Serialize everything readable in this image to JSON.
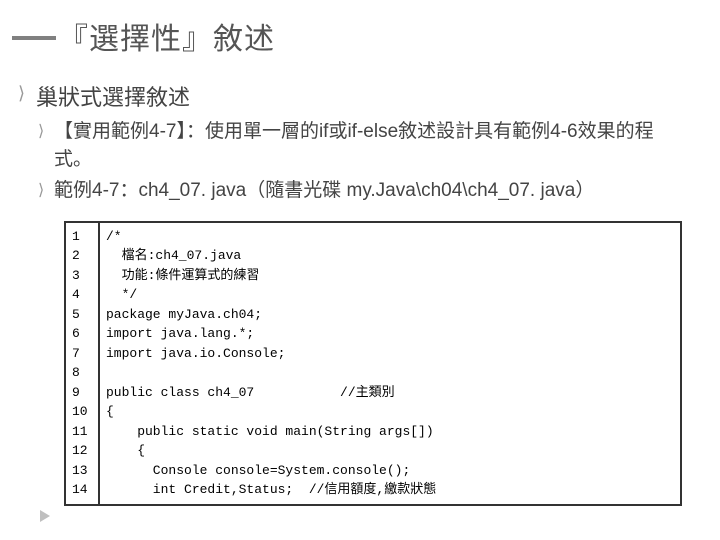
{
  "title": "『選擇性』敘述",
  "bullets": {
    "level1": "巢狀式選擇敘述",
    "sub1": "【實用範例4-7】：使用單一層的if或if-else敘述設計具有範例4-6效果的程式。",
    "sub2": "範例4-7：ch4_07. java（隨書光碟 my.Java\\ch04\\ch4_07. java）"
  },
  "code": {
    "lines": [
      "/*",
      "  檔名:ch4_07.java",
      "  功能:條件運算式的練習",
      "  */",
      "package myJava.ch04;",
      "import java.lang.*;",
      "import java.io.Console;",
      "",
      "public class ch4_07           //主類別",
      "{",
      "    public static void main(String args[])",
      "    {",
      "      Console console=System.console();",
      "      int Credit,Status;  //信用額度,繳款狀態"
    ],
    "numbers": [
      "1",
      "2",
      "3",
      "4",
      "5",
      "6",
      "7",
      "8",
      "9",
      "10",
      "11",
      "12",
      "13",
      "14"
    ]
  }
}
